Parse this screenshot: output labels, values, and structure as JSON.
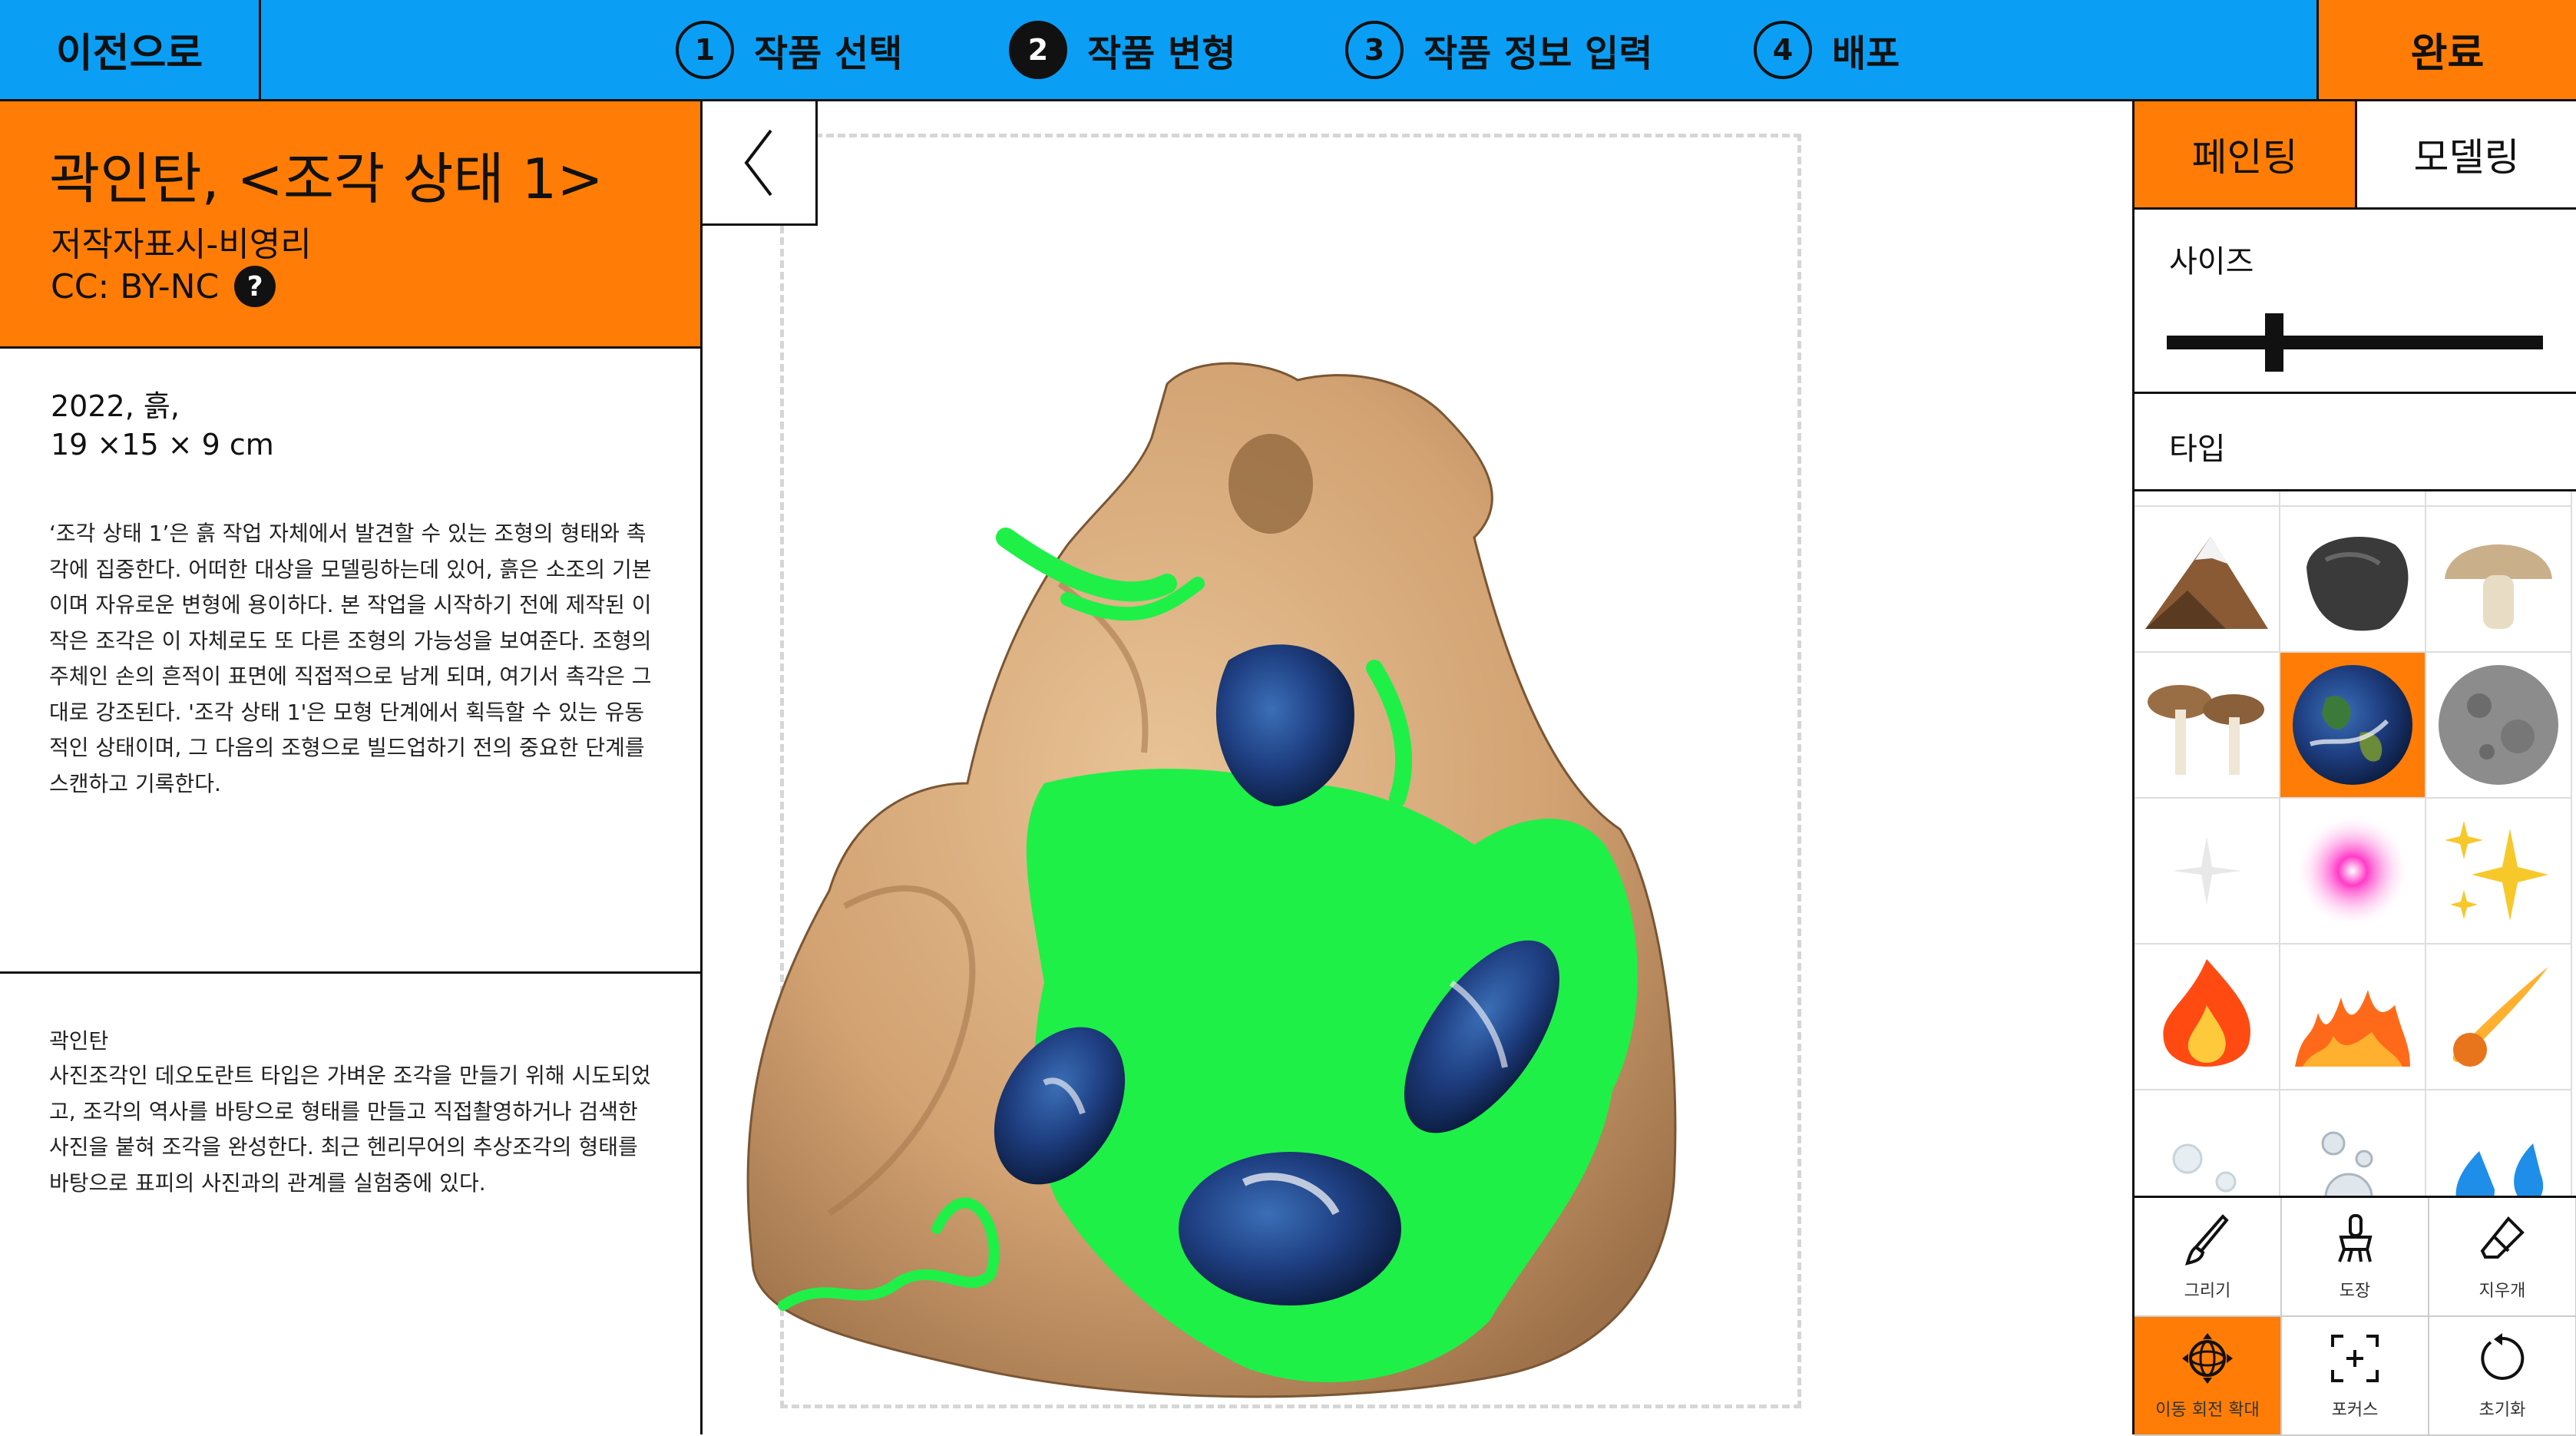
{
  "topbar": {
    "back_label": "이전으로",
    "done_label": "완료",
    "steps": [
      {
        "num": "1",
        "label": "작품 선택"
      },
      {
        "num": "2",
        "label": "작품 변형",
        "active": true
      },
      {
        "num": "3",
        "label": "작품 정보 입력"
      },
      {
        "num": "4",
        "label": "배포"
      }
    ]
  },
  "artwork": {
    "title": "곽인탄, <조각 상태 1>",
    "license": "저작자표시-비영리",
    "cc": "CC: BY-NC",
    "year_material": "2022, 흙,",
    "dimensions": "19 ×15 × 9 cm",
    "description": "‘조각 상태 1’은 흙 작업 자체에서 발견할 수 있는 조형의 형태와 촉각에 집중한다. 어떠한 대상을 모델링하는데 있어, 흙은 소조의 기본이며 자유로운 변형에 용이하다. 본 작업을 시작하기 전에 제작된 이 작은 조각은 이 자체로도 또 다른 조형의 가능성을 보여준다. 조형의 주체인 손의 흔적이 표면에 직접적으로 남게 되며, 여기서 촉각은 그대로 강조된다. '조각 상태 1'은 모형 단계에서 획득할 수 있는 유동적인 상태이며, 그 다음의 조형으로 빌드업하기 전의 중요한 단계를 스캔하고 기록한다.",
    "artist_name": "곽인탄",
    "artist_bio": "사진조각인 데오도란트 타입은 가벼운 조각을 만들기 위해 시도되었고, 조각의 역사를 바탕으로 형태를 만들고 직접촬영하거나 검색한 사진을 붙혀 조각을 완성한다. 최근 헨리무어의 추상조각의 형태를 바탕으로 표피의 사진과의 관계를 실험중에 있다."
  },
  "panel": {
    "tab_paint": "페인팅",
    "tab_model": "모델링",
    "size_label": "사이즈",
    "size_value": 0.18,
    "type_label": "타입",
    "textures": [
      "mountain",
      "rock",
      "mushroom",
      "mushrooms",
      "earth",
      "moon",
      "sparkle-white",
      "glow-pink",
      "sparkles-yellow",
      "fire",
      "flames",
      "comet",
      "water-drops",
      "bubbles",
      "droplets"
    ],
    "selected_texture": "earth",
    "tools": [
      {
        "icon": "brush-icon",
        "label": "그리기"
      },
      {
        "icon": "paint-bucket-icon",
        "label": "도장"
      },
      {
        "icon": "eraser-icon",
        "label": "지우개"
      },
      {
        "icon": "move-rotate-icon",
        "label": "이동 회전 확대",
        "active": true
      },
      {
        "icon": "focus-icon",
        "label": "포커스"
      },
      {
        "icon": "reset-icon",
        "label": "초기화"
      }
    ]
  },
  "colors": {
    "accent": "#ff7d06",
    "topbar": "#0a9ff5",
    "paint": "#1ef047"
  }
}
